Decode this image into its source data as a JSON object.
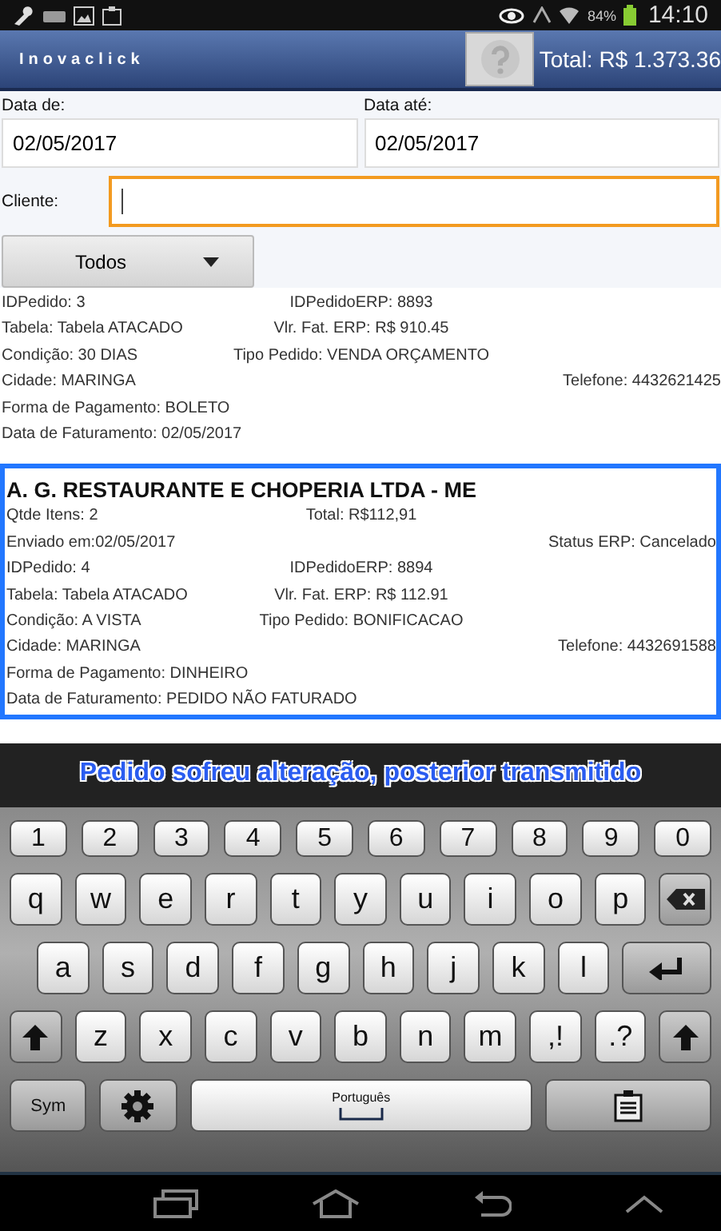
{
  "status_bar": {
    "battery": "84%",
    "time": "14:10"
  },
  "app_bar": {
    "title": "Inovaclick",
    "total": "Total: R$ 1.373.36"
  },
  "filters": {
    "date_from": {
      "label": "Data de:",
      "value": "02/05/2017"
    },
    "date_to": {
      "label": "Data até:",
      "value": "02/05/2017"
    },
    "client": {
      "label": "Cliente:",
      "focused": true
    },
    "status_dropdown": "Todos"
  },
  "orders": [
    {
      "selected": false,
      "lines": [
        {
          "left": "IDPedido: 3",
          "middle": "IDPedidoERP: 8893"
        },
        {
          "left": "Tabela: Tabela ATACADO",
          "middle": "Vlr. Fat. ERP: R$ 910.45"
        },
        {
          "left": "Condição: 30 DIAS",
          "middle": "Tipo Pedido: VENDA ORÇAMENTO"
        },
        {
          "left": "Cidade: MARINGA",
          "right": "Telefone: 4432621425"
        },
        {
          "left": "Forma de Pagamento: BOLETO"
        },
        {
          "left": "Data de Faturamento: 02/05/2017"
        }
      ]
    },
    {
      "selected": true,
      "title": "A. G. RESTAURANTE E CHOPERIA LTDA - ME",
      "lines": [
        {
          "left": "Qtde Itens: 2",
          "middle": "Total: R$112,91"
        },
        {
          "left": "Enviado em:02/05/2017",
          "right": "Status ERP: Cancelado"
        },
        {
          "left": "IDPedido: 4",
          "middle": "IDPedidoERP: 8894"
        },
        {
          "left": "Tabela: Tabela ATACADO",
          "middle": "Vlr. Fat. ERP: R$ 112.91"
        },
        {
          "left": "Condição: A VISTA",
          "middle": "Tipo Pedido: BONIFICACAO"
        },
        {
          "left": "Cidade: MARINGA",
          "right": "Telefone: 4432691588"
        },
        {
          "left": "Forma de Pagamento: DINHEIRO"
        },
        {
          "left": "Data de Faturamento: PEDIDO NÃO FATURADO"
        }
      ]
    }
  ],
  "toast": "Pedido sofreu alteração, posterior transmitido",
  "keyboard": {
    "rows": [
      {
        "keys": [
          {
            "kind": "num",
            "label": "1"
          },
          {
            "kind": "num",
            "label": "2"
          },
          {
            "kind": "num",
            "label": "3"
          },
          {
            "kind": "num",
            "label": "4"
          },
          {
            "kind": "num",
            "label": "5"
          },
          {
            "kind": "num",
            "label": "6"
          },
          {
            "kind": "num",
            "label": "7"
          },
          {
            "kind": "num",
            "label": "8"
          },
          {
            "kind": "num",
            "label": "9"
          },
          {
            "kind": "num",
            "label": "0"
          }
        ]
      },
      {
        "keys": [
          {
            "kind": "char",
            "label": "q"
          },
          {
            "kind": "char",
            "label": "w"
          },
          {
            "kind": "char",
            "label": "e"
          },
          {
            "kind": "char",
            "label": "r"
          },
          {
            "kind": "char",
            "label": "t"
          },
          {
            "kind": "char",
            "label": "y"
          },
          {
            "kind": "char",
            "label": "u"
          },
          {
            "kind": "char",
            "label": "i"
          },
          {
            "kind": "char",
            "label": "o"
          },
          {
            "kind": "char",
            "label": "p"
          },
          {
            "kind": "backspace"
          }
        ]
      },
      {
        "keys": [
          {
            "kind": "char",
            "label": "a"
          },
          {
            "kind": "char",
            "label": "s"
          },
          {
            "kind": "char",
            "label": "d"
          },
          {
            "kind": "char",
            "label": "f"
          },
          {
            "kind": "char",
            "label": "g"
          },
          {
            "kind": "char",
            "label": "h"
          },
          {
            "kind": "char",
            "label": "j"
          },
          {
            "kind": "char",
            "label": "k"
          },
          {
            "kind": "char",
            "label": "l"
          },
          {
            "kind": "enter"
          }
        ]
      },
      {
        "keys": [
          {
            "kind": "shift"
          },
          {
            "kind": "char",
            "label": "z"
          },
          {
            "kind": "char",
            "label": "x"
          },
          {
            "kind": "char",
            "label": "c"
          },
          {
            "kind": "char",
            "label": "v"
          },
          {
            "kind": "char",
            "label": "b"
          },
          {
            "kind": "char",
            "label": "n"
          },
          {
            "kind": "char",
            "label": "m"
          },
          {
            "kind": "char",
            "label": ",!"
          },
          {
            "kind": "char",
            "label": ".?"
          },
          {
            "kind": "shift"
          }
        ]
      },
      {
        "keys": [
          {
            "kind": "sym",
            "label": "Sym"
          },
          {
            "kind": "settings"
          },
          {
            "kind": "space",
            "label": "Português"
          },
          {
            "kind": "clipboard"
          }
        ]
      }
    ]
  }
}
